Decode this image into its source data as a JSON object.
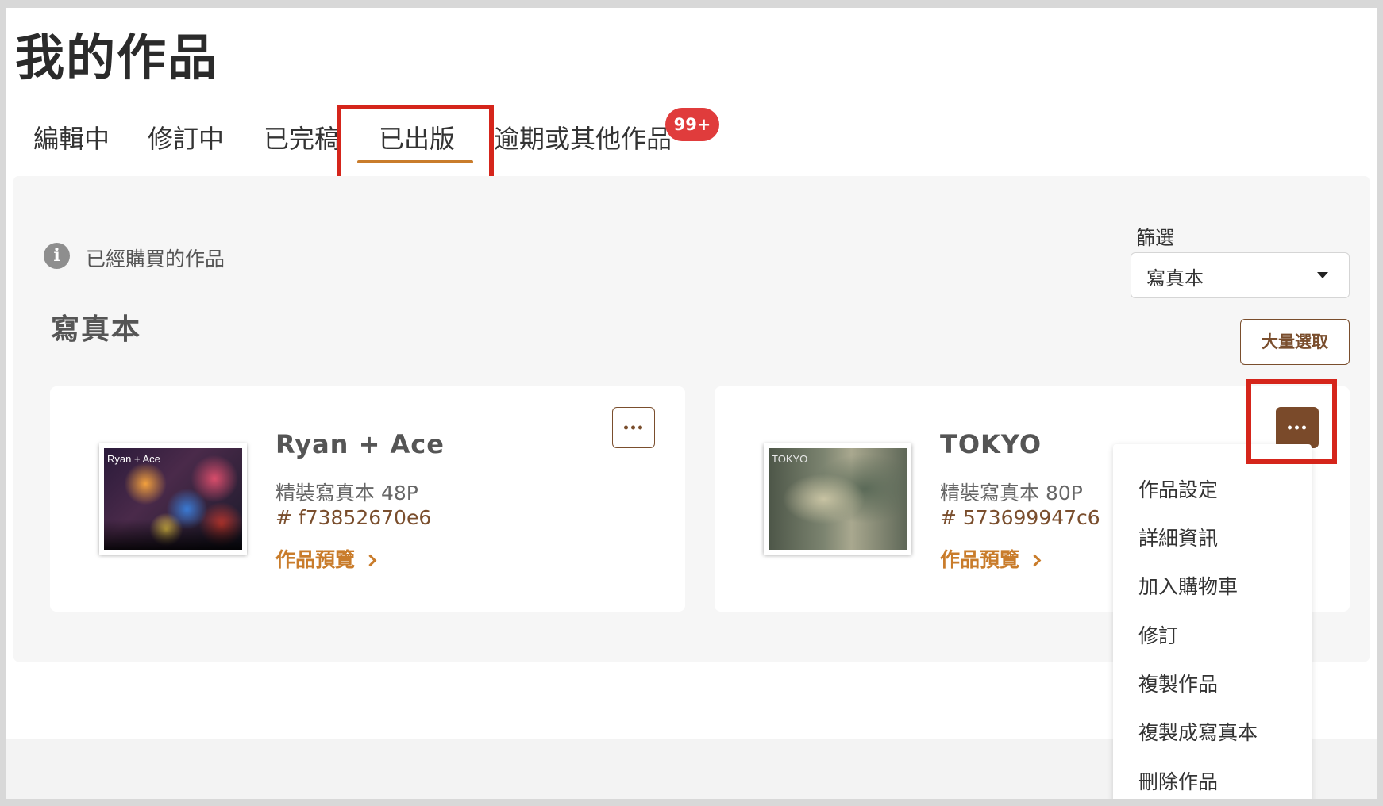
{
  "page": {
    "title": "我的作品"
  },
  "tabs": [
    {
      "label": "編輯中"
    },
    {
      "label": "修訂中"
    },
    {
      "label": "已完稿"
    },
    {
      "label": "已出版",
      "active": true
    },
    {
      "label": "逾期或其他作品",
      "badge": "99+"
    }
  ],
  "info": {
    "text": "已經購買的作品",
    "icon": "info-icon"
  },
  "filter": {
    "label": "篩選",
    "value": "寫真本"
  },
  "section": {
    "title": "寫真本",
    "bulk_select_label": "大量選取"
  },
  "works": [
    {
      "title": "Ryan + Ace",
      "spec": "精裝寫真本 48P",
      "id": "# f73852670e6",
      "preview_label": "作品預覽",
      "thumb_text": "Ryan + Ace"
    },
    {
      "title": "TOKYO",
      "spec": "精裝寫真本 80P",
      "id": "# 573699947c6",
      "preview_label": "作品預覽",
      "thumb_text": "TOKYO"
    }
  ],
  "context_menu": {
    "items": [
      "作品設定",
      "詳細資訊",
      "加入購物車",
      "修訂",
      "複製作品",
      "複製成寫真本",
      "刪除作品"
    ]
  },
  "colors": {
    "accent": "#c97c2b",
    "brown": "#7a4e2d",
    "highlight": "#d5251b",
    "badge": "#e03c3c"
  }
}
